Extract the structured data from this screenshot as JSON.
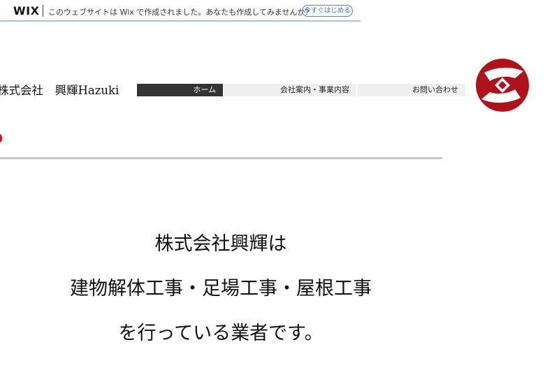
{
  "wix_banner": {
    "logo": "WIX",
    "message": "このウェブサイトは Wix で作成されました。あなたも作成してみませんか？",
    "cta": "今すぐはじめる"
  },
  "header": {
    "site_title": "株式会社　興輝Hazuki",
    "nav": [
      {
        "label": "ホーム",
        "active": true
      },
      {
        "label": "会社案内・事業内容",
        "active": false
      },
      {
        "label": "お問い合わせ",
        "active": false
      }
    ]
  },
  "colors": {
    "accent_red": "#b0121a",
    "nav_active_bg": "#333333",
    "nav_bg": "#efefef",
    "banner_border": "#a9c5ec"
  },
  "main": {
    "lines": [
      "株式会社興輝は",
      "建物解体工事・足場工事・屋根工事",
      "を行っている業者です。"
    ]
  }
}
